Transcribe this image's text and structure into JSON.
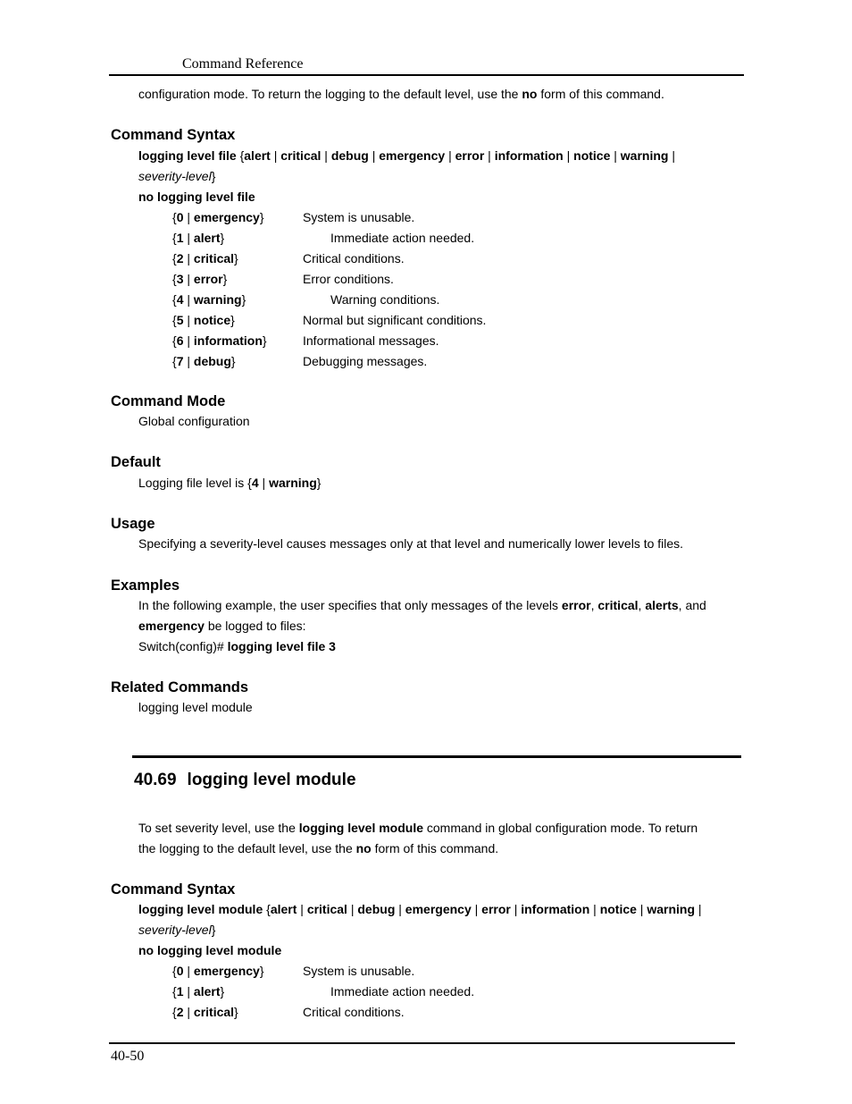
{
  "header": {
    "title": "Command Reference"
  },
  "footer": {
    "page_number": "40-50"
  },
  "intro_continued": {
    "pre": "configuration mode. To return the logging to the default level, use the ",
    "bold": "no",
    "post": " form of this command."
  },
  "section1": {
    "syntax": {
      "heading": "Command Syntax",
      "cmd": "logging level file",
      "open": " {",
      "options": [
        "alert",
        "critical",
        "debug",
        "emergency",
        "error",
        "information",
        "notice",
        "warning"
      ],
      "sep": " | ",
      "trailing_sep": " |",
      "param": "severity-level",
      "close": "}",
      "no_form": "no logging level file"
    },
    "levels": [
      {
        "num": "0",
        "name": "emergency",
        "desc": "System is unusable.",
        "indent": false
      },
      {
        "num": "1",
        "name": "alert",
        "desc": "Immediate action needed.",
        "indent": true
      },
      {
        "num": "2",
        "name": "critical",
        "desc": "Critical conditions.",
        "indent": false
      },
      {
        "num": "3",
        "name": "error",
        "desc": "Error conditions.",
        "indent": false
      },
      {
        "num": "4",
        "name": "warning",
        "desc": "Warning conditions.",
        "indent": true
      },
      {
        "num": "5",
        "name": "notice",
        "desc": "Normal but significant conditions.",
        "indent": false
      },
      {
        "num": "6",
        "name": "information",
        "desc": "Informational messages.",
        "indent": false
      },
      {
        "num": "7",
        "name": "debug",
        "desc": "Debugging messages.",
        "indent": false
      }
    ],
    "mode": {
      "heading": "Command Mode",
      "text": "Global configuration"
    },
    "default": {
      "heading": "Default",
      "pre": "Logging file level is {",
      "num": "4",
      "sep": " | ",
      "name": "warning",
      "close": "}"
    },
    "usage": {
      "heading": "Usage",
      "text": "Specifying a severity-level causes messages only at that level and numerically lower levels to files."
    },
    "examples": {
      "heading": "Examples",
      "line1_pre": "In the following example, the user specifies that only messages of the levels ",
      "b1": "error",
      "c1": ", ",
      "b2": "critical",
      "c2": ", ",
      "b3": "alerts",
      "c3": ", and",
      "b4": "emergency",
      "line2_post": " be logged to files:",
      "prompt": "Switch(config)# ",
      "command": "logging level file 3"
    },
    "related": {
      "heading": "Related Commands",
      "text": "logging level module"
    }
  },
  "section2": {
    "number": "40.69",
    "title": "logging level module",
    "intro": {
      "pre": "To set severity level, use the ",
      "bold": "logging level module",
      "post": " command in global configuration mode. To return",
      "line2_pre": "the logging to the default level, use the ",
      "line2_bold": "no",
      "line2_post": " form of this command."
    },
    "syntax": {
      "heading": "Command Syntax",
      "cmd": "logging level module",
      "open": " {",
      "options": [
        "alert",
        "critical",
        "debug",
        "emergency",
        "error",
        "information",
        "notice",
        "warning"
      ],
      "sep": " | ",
      "trailing_sep": " |",
      "param": "severity-level",
      "close": "}",
      "no_form": "no logging level module"
    },
    "levels": [
      {
        "num": "0",
        "name": "emergency",
        "desc": "System is unusable.",
        "indent": false
      },
      {
        "num": "1",
        "name": "alert",
        "desc": "Immediate action needed.",
        "indent": true
      },
      {
        "num": "2",
        "name": "critical",
        "desc": "Critical conditions.",
        "indent": false
      }
    ]
  }
}
